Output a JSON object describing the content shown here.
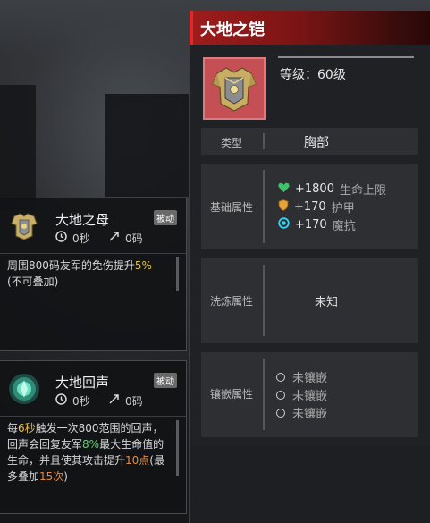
{
  "item": {
    "title": "大地之铠",
    "level": "等级：60级",
    "icon": "armor-chestplate-icon",
    "colors": {
      "header_red": "#9e1c1c",
      "accent": "#e02a2a",
      "icon_bg": "#c45055"
    },
    "type_label": "类型",
    "type_value": "胸部",
    "base_label": "基础属性",
    "base_stats": [
      {
        "icon": "green-heart-icon",
        "value": "+1800",
        "name": "生命上限"
      },
      {
        "icon": "orange-shield-icon",
        "value": "+170",
        "name": "护甲"
      },
      {
        "icon": "cyan-ring-icon",
        "value": "+170",
        "name": "魔抗"
      }
    ],
    "refine_label": "洗炼属性",
    "refine_value": "未知",
    "socket_label": "镶嵌属性",
    "sockets": [
      "未镶嵌",
      "未镶嵌",
      "未镶嵌"
    ]
  },
  "skills": [
    {
      "name": "大地之母",
      "badge": "被动",
      "icon": "golden-armor-icon",
      "cooldown": "0秒",
      "range": "0码",
      "desc_parts": [
        "周围800码友军的免伤提升",
        "5%",
        "(不可叠加)"
      ]
    },
    {
      "name": "大地回声",
      "badge": "被动",
      "icon": "green-spirit-icon",
      "cooldown": "0秒",
      "range": "0码",
      "desc_parts": [
        "每",
        "6秒",
        "触发一次800范围的回声，回声会回复友军",
        "8%",
        "最大生命值的生命，并且使其攻击提升",
        "10点",
        "(最多叠加",
        "15次",
        ")"
      ]
    }
  ]
}
